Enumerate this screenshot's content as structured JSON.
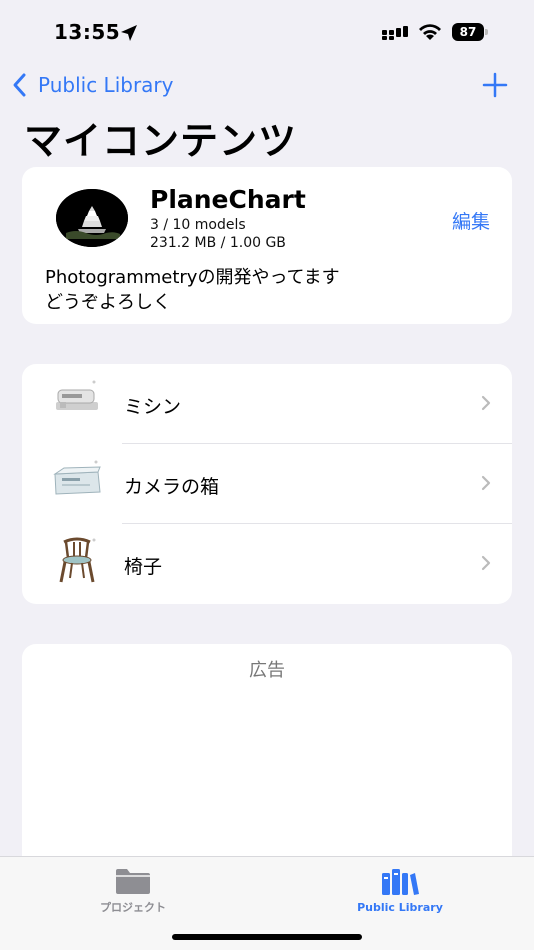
{
  "status_bar": {
    "time": "13:55",
    "battery": "87",
    "icons": [
      "location-arrow-icon",
      "signal-icon",
      "wifi-icon",
      "battery-icon"
    ]
  },
  "nav": {
    "back_label": "Public Library",
    "add_icon": "plus-icon"
  },
  "page_title": "マイコンテンツ",
  "profile": {
    "name": "PlaneChart",
    "models": "3 / 10 models",
    "storage": "231.2 MB / 1.00 GB",
    "edit_label": "編集",
    "bio": "Photogrammetryの開発やってます\nどうぞよろしく"
  },
  "items": [
    {
      "label": "ミシン",
      "icon": "sewing-machine-thumbnail"
    },
    {
      "label": "カメラの箱",
      "icon": "camera-box-thumbnail"
    },
    {
      "label": "椅子",
      "icon": "chair-thumbnail"
    }
  ],
  "ad": {
    "label": "広告"
  },
  "tabs": [
    {
      "label": "プロジェクト",
      "icon": "folder-icon",
      "active": false
    },
    {
      "label": "Public Library",
      "icon": "library-icon",
      "active": true
    }
  ],
  "colors": {
    "accent": "#3478f6",
    "background": "#f1f0f6",
    "card": "#ffffff",
    "inactive_tab": "#8e8e93"
  }
}
